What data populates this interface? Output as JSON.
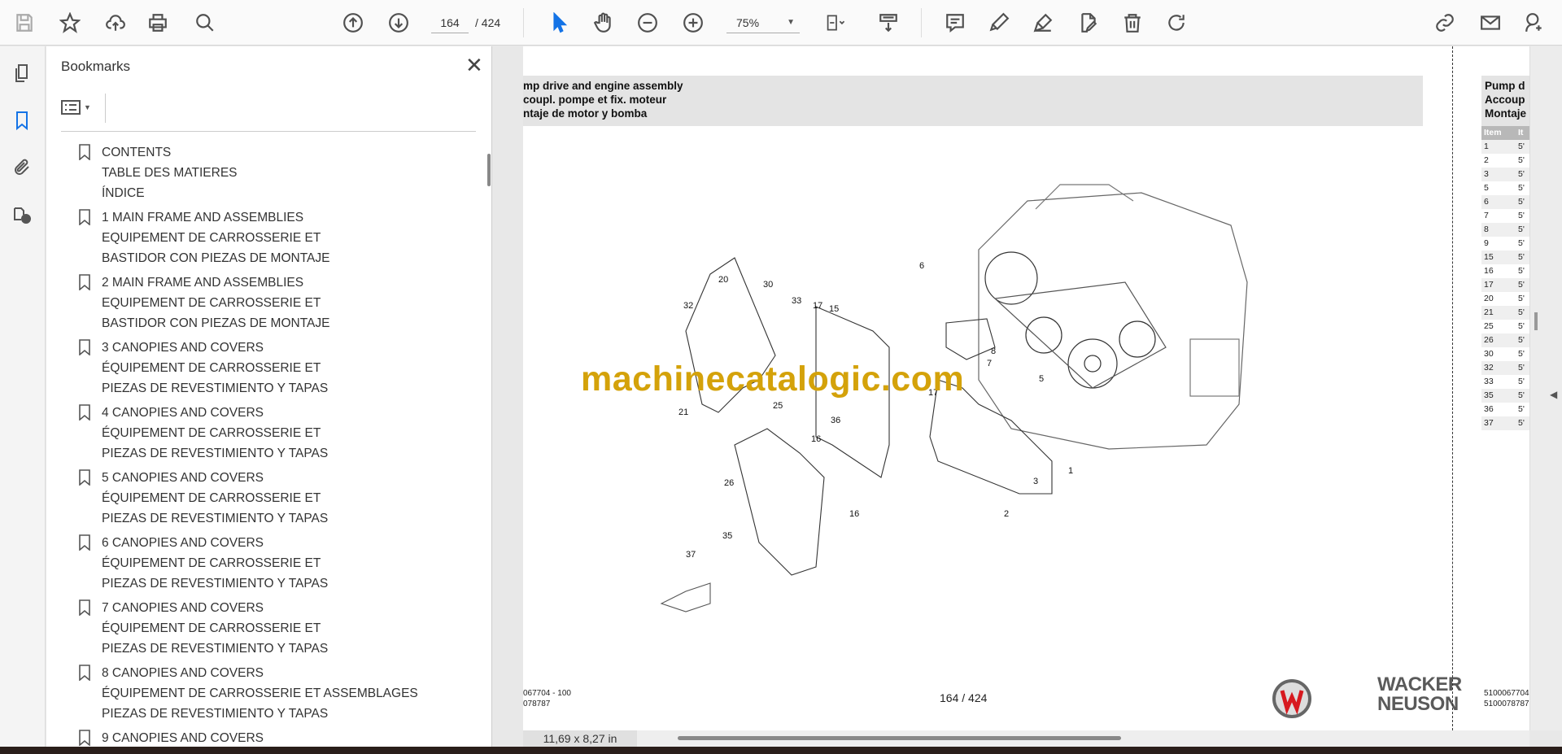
{
  "toolbar": {
    "page_current": "164",
    "page_total": "/ 424",
    "zoom": "75%"
  },
  "bookmarks": {
    "title": "Bookmarks",
    "items": [
      {
        "lines": [
          "CONTENTS",
          "TABLE DES MATIERES",
          "ÍNDICE"
        ]
      },
      {
        "lines": [
          "1 MAIN FRAME AND ASSEMBLIES",
          "EQUIPEMENT DE CARROSSERIE ET",
          "BASTIDOR CON PIEZAS DE MONTAJE"
        ]
      },
      {
        "lines": [
          "2 MAIN FRAME AND ASSEMBLIES",
          "EQUIPEMENT DE CARROSSERIE ET",
          "BASTIDOR CON PIEZAS DE MONTAJE"
        ]
      },
      {
        "lines": [
          "3 CANOPIES AND COVERS",
          "ÉQUIPEMENT DE CARROSSERIE ET",
          "PIEZAS DE REVESTIMIENTO Y TAPAS"
        ]
      },
      {
        "lines": [
          "4 CANOPIES AND COVERS",
          "ÉQUIPEMENT DE CARROSSERIE ET",
          "PIEZAS DE REVESTIMIENTO Y TAPAS"
        ]
      },
      {
        "lines": [
          "5 CANOPIES AND COVERS",
          "ÉQUIPEMENT DE CARROSSERIE ET",
          "PIEZAS DE REVESTIMIENTO Y TAPAS"
        ]
      },
      {
        "lines": [
          "6 CANOPIES AND COVERS",
          "ÉQUIPEMENT DE CARROSSERIE ET",
          "PIEZAS DE REVESTIMIENTO Y TAPAS"
        ]
      },
      {
        "lines": [
          "7 CANOPIES AND COVERS",
          "ÉQUIPEMENT DE CARROSSERIE ET",
          "PIEZAS DE REVESTIMIENTO Y TAPAS"
        ]
      },
      {
        "lines": [
          "8 CANOPIES AND COVERS",
          "ÉQUIPEMENT DE CARROSSERIE ET ASSEMBLAGES",
          "PIEZAS DE REVESTIMIENTO Y TAPAS"
        ]
      },
      {
        "lines": [
          "9 CANOPIES AND COVERS"
        ]
      }
    ]
  },
  "page": {
    "header": [
      "mp drive and engine assembly",
      "coupl. pompe et fix. moteur",
      "ntaje de motor y bomba"
    ],
    "callouts": [
      "20",
      "30",
      "33",
      "17",
      "15",
      "6",
      "32",
      "8",
      "7",
      "17",
      "5",
      "21",
      "25",
      "36",
      "16",
      "1",
      "3",
      "26",
      "16",
      "2",
      "35",
      "37"
    ],
    "watermark": "machinecatalogic.com",
    "footer_left": [
      "067704 - 100",
      "078787"
    ],
    "footer_page": "164 / 424",
    "logo_text": [
      "WACKER",
      "NEUSON"
    ]
  },
  "next_page": {
    "header": [
      "Pump d",
      "Accoup",
      "Montaje"
    ],
    "columns": [
      "Item",
      "It"
    ],
    "rows": [
      "1",
      "2",
      "3",
      "5",
      "6",
      "7",
      "8",
      "9",
      "15",
      "16",
      "17",
      "20",
      "21",
      "25",
      "26",
      "30",
      "32",
      "33",
      "35",
      "36",
      "37"
    ],
    "cell_prefix": "5'",
    "footer": [
      "5100067704",
      "5100078787"
    ]
  },
  "status": {
    "page_size": "11,69 x 8,27 in"
  },
  "colors": {
    "watermark": "#d4a20a",
    "select_tool": "#1473e6",
    "logo_red": "#d7191f"
  }
}
